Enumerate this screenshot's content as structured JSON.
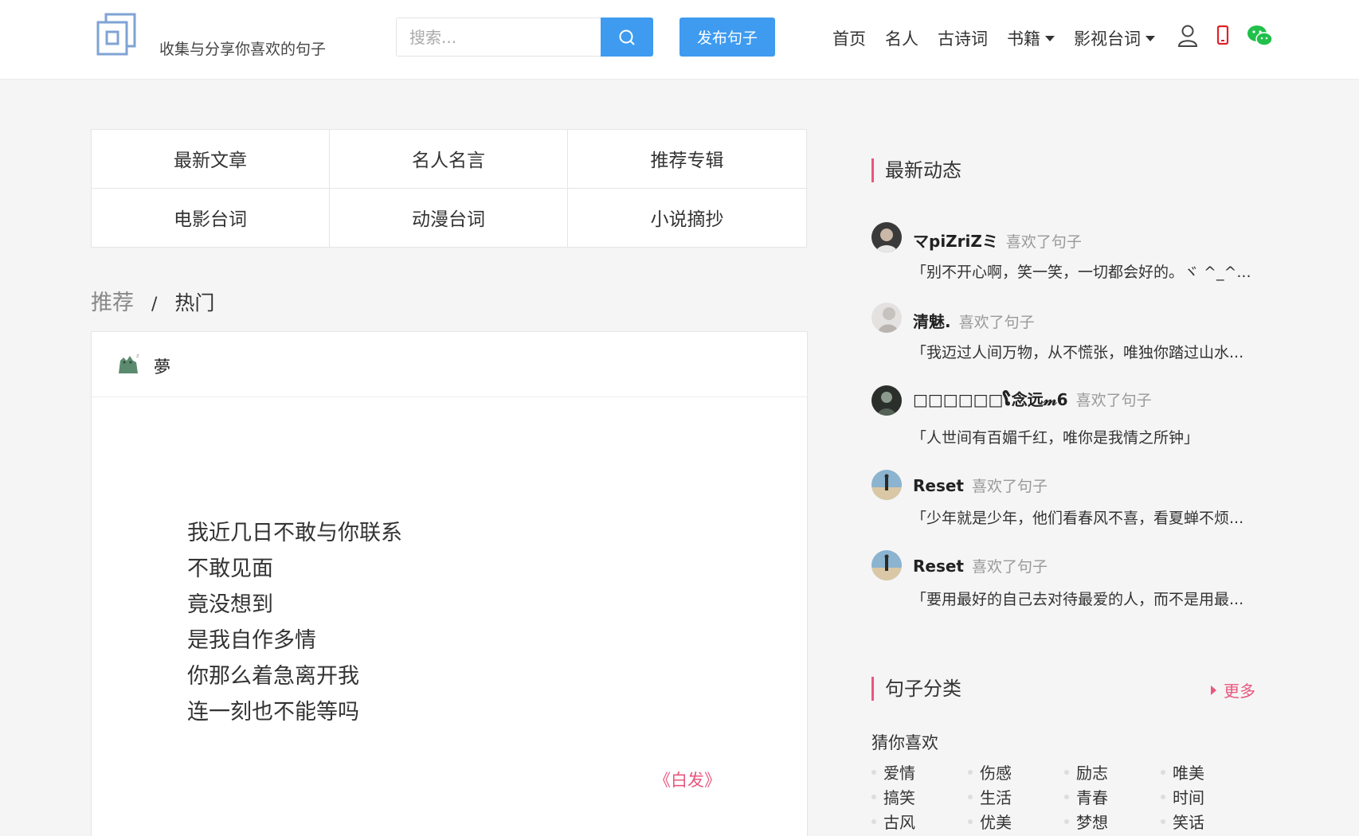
{
  "header": {
    "tagline": "收集与分享你喜欢的句子",
    "search_placeholder": "搜索...",
    "publish_label": "发布句子",
    "nav": [
      {
        "label": "首页"
      },
      {
        "label": "名人"
      },
      {
        "label": "古诗词"
      },
      {
        "label": "书籍"
      },
      {
        "label": "影视台词"
      }
    ],
    "icons": [
      "user-icon",
      "mobile-icon",
      "wechat-icon"
    ]
  },
  "categories": [
    "最新文章",
    "名人名言",
    "推荐专辑",
    "电影台词",
    "动漫台词",
    "小说摘抄"
  ],
  "tabs": {
    "recommend": "推荐",
    "separator": "/",
    "hot": "热门"
  },
  "post": {
    "user": "夢",
    "lines": [
      "我近几日不敢与你联系",
      "不敢见面",
      "竟没想到",
      "是我自作多情",
      "你那么着急离开我",
      "连一刻也不能等吗"
    ],
    "source": "《白发》"
  },
  "sidebar": {
    "activity_title": "最新动态",
    "activities": [
      {
        "name": "マpiZriZミ",
        "action": "喜欢了句子",
        "text": "「别不开心啊，笑一笑，一切都会好的。ヾ ^_^..."
      },
      {
        "name": "清魅.",
        "action": "喜欢了句子",
        "text": "「我迈过人间万物，从不慌张，唯独你踏过山水..."
      },
      {
        "name": "□□□□□□ໂ念远𝓂6",
        "action": "喜欢了句子",
        "text": "「人世间有百媚千红，唯你是我情之所钟」"
      },
      {
        "name": "Reset",
        "action": "喜欢了句子",
        "text": "「少年就是少年，他们看春风不喜，看夏蝉不烦..."
      },
      {
        "name": "Reset",
        "action": "喜欢了句子",
        "text": "「要用最好的自己去对待最爱的人，而不是用最..."
      }
    ],
    "category_title": "句子分类",
    "more_label": "更多",
    "guess_label": "猜你喜欢",
    "tags": [
      "爱情",
      "伤感",
      "励志",
      "唯美",
      "搞笑",
      "生活",
      "青春",
      "时间",
      "古风",
      "优美",
      "梦想",
      "笑话"
    ]
  },
  "colors": {
    "accent_blue": "#3e9bf0",
    "accent_pink": "#e8577e"
  }
}
